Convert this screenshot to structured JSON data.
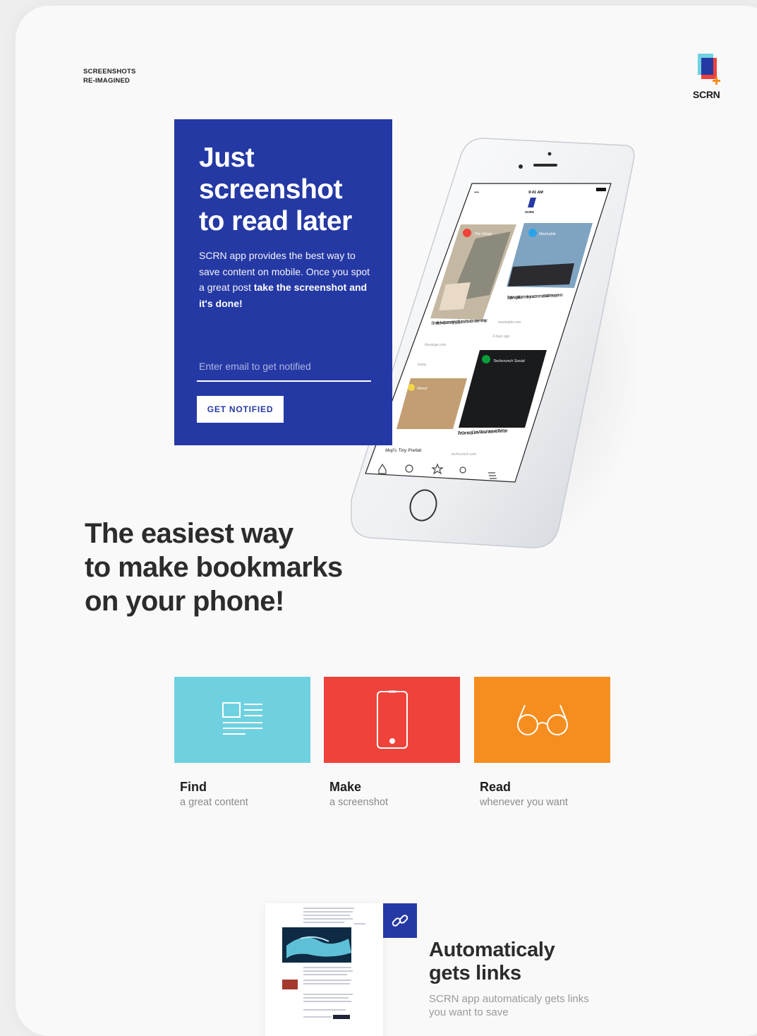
{
  "header": {
    "tagline_line1": "SCREENSHOTS",
    "tagline_line2": "RE-IMAGINED",
    "logo_text": "SCRN"
  },
  "hero": {
    "title_line1": "Just",
    "title_line2": "screenshot",
    "title_line3": "to read later",
    "desc_plain": "SCRN app provides the best way to save content on mobile. Once you spot a great post ",
    "desc_bold": "take the screenshot and it's done!",
    "email_placeholder": "Enter email to get notified",
    "button_label": "GET NOTIFIED",
    "color": "#2539a4"
  },
  "phone": {
    "status_carrier": "•••• ",
    "status_time": "9:41 AM",
    "app_name": "SCRN",
    "cards": [
      {
        "source": "The Verge",
        "title": "Smaller developers are trying to figure out how to make money",
        "domain": "theverge.com",
        "meta": "today"
      },
      {
        "source": "Mashable",
        "title": "Tesla's Autopilot can make your commute better in new promo",
        "domain": "mashable.com",
        "meta": "2 days ago"
      },
      {
        "source": "Wired",
        "title": "Muji's Tiny Prefab",
        "domain": "",
        "meta": ""
      },
      {
        "source": "Techcrunch Social",
        "title": "The Samsung Gear VR is Your Window Into The Future",
        "domain": "techcrunch.com",
        "meta": ""
      }
    ],
    "nav_icons": [
      "home-icon",
      "compass-icon",
      "star-icon",
      "search-icon",
      "menu-icon"
    ]
  },
  "headline": {
    "line1": "The easiest way",
    "line2": "to make bookmarks",
    "line3": "on your phone!"
  },
  "features": [
    {
      "title": "Find",
      "subtitle": "a great content",
      "color": "#6fd1e0",
      "icon": "newspaper-icon"
    },
    {
      "title": "Make",
      "subtitle": "a screenshot",
      "color": "#ef423a",
      "icon": "phone-icon"
    },
    {
      "title": "Read",
      "subtitle": "whenever you want",
      "color": "#f68e1f",
      "icon": "glasses-icon"
    }
  ],
  "auto_links": {
    "title_line1": "Automaticaly",
    "title_line2": "gets links",
    "desc": "SCRN app automaticaly gets links you want to save",
    "badge_icon": "link-icon"
  }
}
